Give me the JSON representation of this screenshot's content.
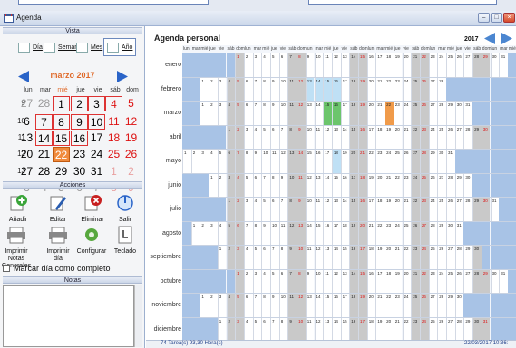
{
  "window": {
    "title": "Agenda"
  },
  "vista": {
    "header": "Vista",
    "buttons": [
      {
        "label": "Día"
      },
      {
        "label": "Semana"
      },
      {
        "label": "Mes"
      },
      {
        "label": "Año"
      }
    ]
  },
  "calendar": {
    "month_title": "marzo 2017",
    "day_headers": [
      "lun",
      "mar",
      "mié",
      "jue",
      "vie",
      "sáb",
      "dom"
    ],
    "weeks": [
      {
        "num": "9",
        "days": [
          "27",
          "28",
          "1",
          "2",
          "3",
          "4",
          "5"
        ]
      },
      {
        "num": "10",
        "days": [
          "6",
          "7",
          "8",
          "9",
          "10",
          "11",
          "12"
        ]
      },
      {
        "num": "11",
        "days": [
          "13",
          "14",
          "15",
          "16",
          "17",
          "18",
          "19"
        ]
      },
      {
        "num": "12",
        "days": [
          "20",
          "21",
          "22",
          "23",
          "24",
          "25",
          "26"
        ]
      },
      {
        "num": "13",
        "days": [
          "27",
          "28",
          "29",
          "30",
          "31",
          "1",
          "2"
        ]
      },
      {
        "num": "14",
        "days": [
          "3",
          "4",
          "5",
          "6",
          "7",
          "8",
          "9"
        ]
      }
    ]
  },
  "acciones": {
    "header": "Acciones",
    "buttons": [
      "Añadir",
      "Editar",
      "Eliminar",
      "Salir"
    ],
    "buttons2": [
      "Imprimir Notas Generales",
      "Imprimir día",
      "Configurar",
      "Teclado"
    ]
  },
  "mark_label": "Marcar día como completo",
  "notas_header": "Notas",
  "agenda": {
    "title": "Agenda personal",
    "year": "2017",
    "day_abbrev": [
      "lun",
      "mar",
      "mié",
      "jue",
      "vie",
      "sáb",
      "dom"
    ],
    "months": [
      "enero",
      "febrero",
      "marzo",
      "abril",
      "mayo",
      "junio",
      "julio",
      "agosto",
      "septiembre",
      "octubre",
      "noviembre",
      "diciembre"
    ]
  },
  "status": {
    "left": "74 Tarea(s)  93,30 Hora(s)",
    "right": "22/03/2017  10:36:"
  },
  "colors": {
    "accent": "#2a64c8",
    "today": "#f08a3c",
    "weekend_number": "#dd1111"
  }
}
